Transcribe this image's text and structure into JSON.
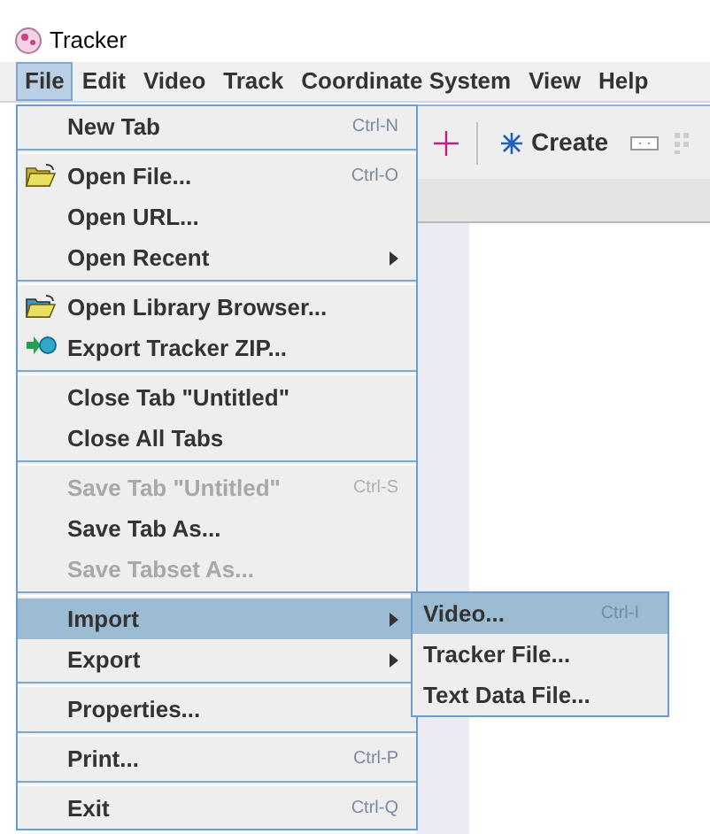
{
  "window": {
    "title": "Tracker"
  },
  "menu_bar": [
    {
      "label": "File",
      "selected": true
    },
    {
      "label": "Edit",
      "selected": false
    },
    {
      "label": "Video",
      "selected": false
    },
    {
      "label": "Track",
      "selected": false
    },
    {
      "label": "Coordinate System",
      "selected": false
    },
    {
      "label": "View",
      "selected": false
    },
    {
      "label": "Help",
      "selected": false
    }
  ],
  "toolbar": {
    "create_button": "Create"
  },
  "file_menu": [
    [
      {
        "label": "New Tab",
        "shortcut": "Ctrl-N",
        "kind": "plain",
        "disabled": false,
        "selected": false,
        "submenu": false
      }
    ],
    [
      {
        "label": "Open File...",
        "shortcut": "Ctrl-O",
        "kind": "open",
        "disabled": false,
        "selected": false,
        "submenu": false
      },
      {
        "label": "Open URL...",
        "kind": "plain",
        "disabled": false,
        "selected": false,
        "submenu": false
      },
      {
        "label": "Open Recent",
        "kind": "plain",
        "disabled": false,
        "selected": false,
        "submenu": true
      }
    ],
    [
      {
        "label": "Open Library Browser...",
        "kind": "library",
        "disabled": false,
        "selected": false,
        "submenu": false
      },
      {
        "label": "Export Tracker ZIP...",
        "kind": "zip",
        "disabled": false,
        "selected": false,
        "submenu": false
      }
    ],
    [
      {
        "label": "Close Tab \"Untitled\"",
        "kind": "plain",
        "disabled": false,
        "selected": false,
        "submenu": false
      },
      {
        "label": "Close All Tabs",
        "kind": "plain",
        "disabled": false,
        "selected": false,
        "submenu": false
      }
    ],
    [
      {
        "label": "Save Tab \"Untitled\"",
        "shortcut": "Ctrl-S",
        "kind": "plain",
        "disabled": true,
        "selected": false,
        "submenu": false
      },
      {
        "label": "Save Tab As...",
        "kind": "plain",
        "disabled": false,
        "selected": false,
        "submenu": false
      },
      {
        "label": "Save Tabset As...",
        "kind": "plain",
        "disabled": true,
        "selected": false,
        "submenu": false
      }
    ],
    [
      {
        "label": "Import",
        "kind": "plain",
        "disabled": false,
        "selected": true,
        "submenu": true
      },
      {
        "label": "Export",
        "kind": "plain",
        "disabled": false,
        "selected": false,
        "submenu": true
      }
    ],
    [
      {
        "label": "Properties...",
        "kind": "plain",
        "disabled": false,
        "selected": false,
        "submenu": false
      }
    ],
    [
      {
        "label": "Print...",
        "shortcut": "Ctrl-P",
        "kind": "plain",
        "disabled": false,
        "selected": false,
        "submenu": false
      }
    ],
    [
      {
        "label": "Exit",
        "shortcut": "Ctrl-Q",
        "kind": "plain",
        "disabled": false,
        "selected": false,
        "submenu": false
      }
    ]
  ],
  "import_submenu": [
    {
      "label": "Video...",
      "shortcut": "Ctrl-I",
      "selected": true
    },
    {
      "label": "Tracker File...",
      "selected": false
    },
    {
      "label": "Text Data File...",
      "selected": false
    }
  ]
}
